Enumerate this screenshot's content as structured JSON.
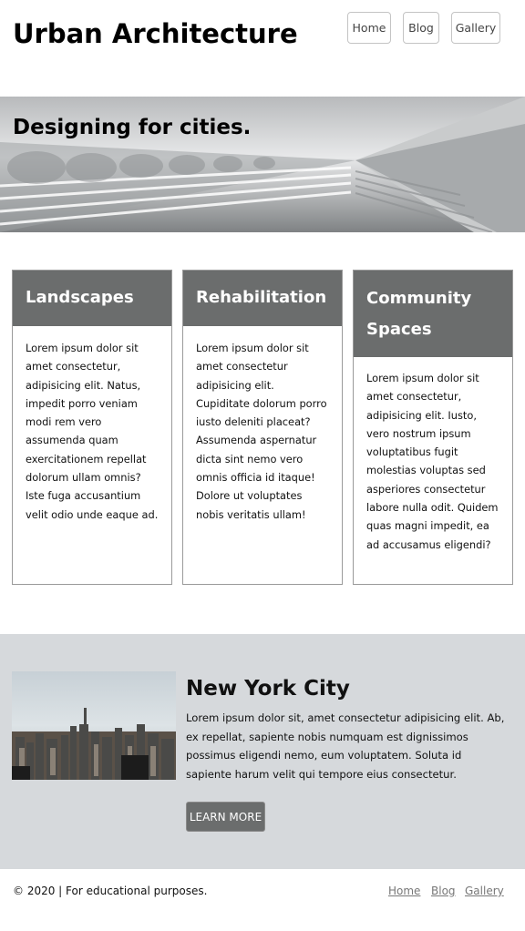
{
  "header": {
    "title": "Urban Architecture",
    "nav": [
      "Home",
      "Blog",
      "Gallery"
    ]
  },
  "hero": {
    "text": "Designing for cities."
  },
  "cards": [
    {
      "title": "Landscapes",
      "body": "Lorem ipsum dolor sit amet consectetur, adipisicing elit. Natus, impedit porro veniam modi rem vero assumenda quam exercitationem repellat dolorum ullam omnis? Iste fuga accusantium velit odio unde eaque ad."
    },
    {
      "title": "Rehabilitation",
      "body": "Lorem ipsum dolor sit amet consectetur adipisicing elit. Cupiditate dolorum porro iusto deleniti placeat? Assumenda aspernatur dicta sint nemo vero omnis officia id itaque! Dolore ut voluptates nobis veritatis ullam!"
    },
    {
      "title": "Community Spaces",
      "body": "Lorem ipsum dolor sit amet consectetur, adipisicing elit. Iusto, vero nostrum ipsum voluptatibus fugit molestias voluptas sed asperiores consectetur labore nulla odit. Quidem quas magni impedit, ea ad accusamus eligendi?"
    }
  ],
  "feature": {
    "title": "New York City",
    "text": "Lorem ipsum dolor sit, amet consectetur adipisicing elit. Ab, ex repellat, sapiente nobis numquam est dignissimos possimus eligendi nemo, eum voluptatem. Soluta id sapiente harum velit qui tempore eius consectetur.",
    "button": "LEARN MORE"
  },
  "footer": {
    "text": "© 2020 | For educational purposes.",
    "links": [
      "Home",
      "Blog",
      "Gallery"
    ]
  },
  "colors": {
    "card_header": "#6b6d6d",
    "feature_bg": "#d6d9dc",
    "button_bg": "#6b6d6d"
  }
}
